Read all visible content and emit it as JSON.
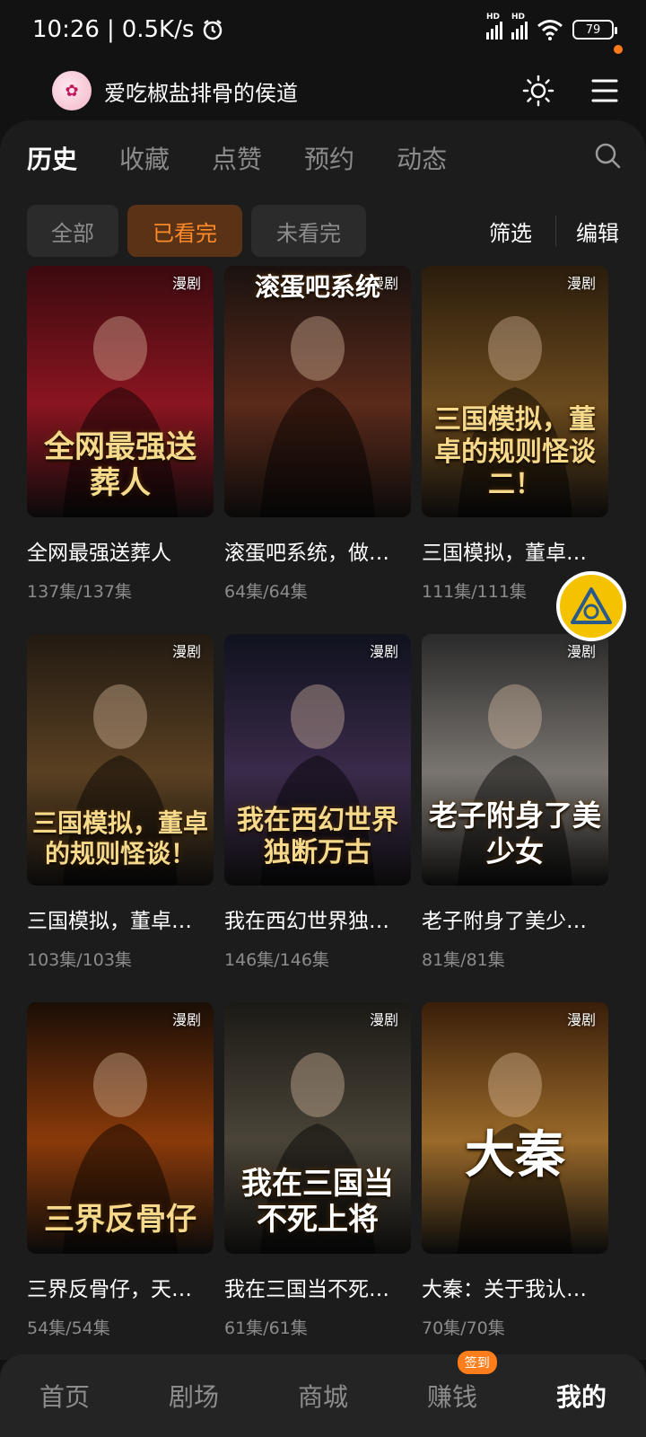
{
  "status_bar": {
    "time": "10:26",
    "speed": "0.5K/s",
    "battery": "79"
  },
  "header": {
    "username": "爱吃椒盐排骨的侯道"
  },
  "tabs": [
    {
      "label": "历史",
      "active": true
    },
    {
      "label": "收藏",
      "active": false
    },
    {
      "label": "点赞",
      "active": false
    },
    {
      "label": "预约",
      "active": false
    },
    {
      "label": "动态",
      "active": false
    }
  ],
  "filters": {
    "chips": [
      {
        "label": "全部",
        "active": false
      },
      {
        "label": "已看完",
        "active": true
      },
      {
        "label": "未看完",
        "active": false
      }
    ],
    "filter_label": "筛选",
    "edit_label": "编辑"
  },
  "items": [
    {
      "tag": "漫剧",
      "cover_text": "全网最强送葬人",
      "title": "全网最强送葬人",
      "episodes": "137集/137集",
      "palette": [
        "#3b0a0f",
        "#8a1520"
      ]
    },
    {
      "tag": "漫剧",
      "cover_text": "滚蛋吧系统",
      "title": "滚蛋吧系统，做…",
      "episodes": "64集/64集",
      "palette": [
        "#1a1210",
        "#5a2a1a"
      ]
    },
    {
      "tag": "漫剧",
      "cover_text": "三国模拟，董卓的规则怪谈二！",
      "title": "三国模拟，董卓…",
      "episodes": "111集/111集",
      "palette": [
        "#2a1c0c",
        "#6b4a1e"
      ]
    },
    {
      "tag": "漫剧",
      "cover_text": "三国模拟，董卓的规则怪谈！",
      "title": "三国模拟，董卓…",
      "episodes": "103集/103集",
      "palette": [
        "#221a12",
        "#5a4022"
      ]
    },
    {
      "tag": "漫剧",
      "cover_text": "我在西幻世界独断万古",
      "title": "我在西幻世界独…",
      "episodes": "146集/146集",
      "palette": [
        "#10121e",
        "#3a2a4a"
      ]
    },
    {
      "tag": "漫剧",
      "cover_text": "老子附身了美少女",
      "title": "老子附身了美少…",
      "episodes": "81集/81集",
      "palette": [
        "#2a2a2a",
        "#7a7570"
      ]
    },
    {
      "tag": "漫剧",
      "cover_text": "三界反骨仔",
      "title": "三界反骨仔，天…",
      "episodes": "54集/54集",
      "palette": [
        "#1a0e06",
        "#8a3a0a"
      ]
    },
    {
      "tag": "漫剧",
      "cover_text": "我在三国当不死上将",
      "title": "我在三国当不死…",
      "episodes": "61集/61集",
      "palette": [
        "#1c1a16",
        "#4a4438"
      ]
    },
    {
      "tag": "漫剧",
      "cover_text": "大秦",
      "title": "大秦：关于我认…",
      "episodes": "70集/70集",
      "palette": [
        "#3a1e0a",
        "#9a6a2a"
      ]
    }
  ],
  "bottom_nav": [
    {
      "label": "首页",
      "active": false
    },
    {
      "label": "剧场",
      "active": false
    },
    {
      "label": "商城",
      "active": false
    },
    {
      "label": "赚钱",
      "active": false,
      "badge": "签到"
    },
    {
      "label": "我的",
      "active": true
    }
  ]
}
